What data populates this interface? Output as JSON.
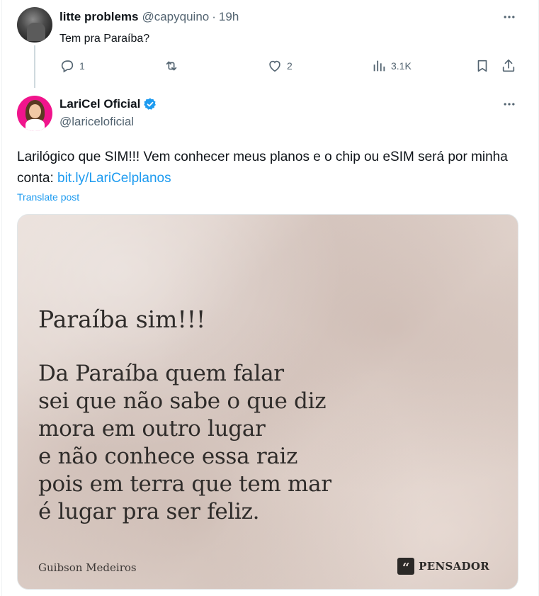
{
  "reply": {
    "name": "litte problems",
    "handle": "@capyquino",
    "separator": "·",
    "time": "19h",
    "text": "Tem pra Paraíba?",
    "actions": {
      "reply_count": "1",
      "retweet_count": "",
      "like_count": "2",
      "view_count": "3.1K"
    }
  },
  "main": {
    "name": "LariCel Oficial",
    "handle": "@lariceloficial",
    "verified": true,
    "text_prefix": "Larilógico que SIM!!! Vem conhecer meus planos e o chip ou eSIM  será por minha conta: ",
    "link": "bit.ly/LariCelplanos",
    "translate": "Translate post"
  },
  "media": {
    "title": "Paraíba sim!!!",
    "lines": [
      "Da Paraíba quem falar",
      "sei que não sabe o que diz",
      "mora em outro lugar",
      "e não conhece essa raiz",
      "pois em terra que tem mar",
      "é lugar pra ser feliz."
    ],
    "author": "Guibson Medeiros",
    "brand": "PENSADOR",
    "brand_mark": "“"
  },
  "icons": {
    "more": "more-icon",
    "reply": "reply-icon",
    "retweet": "retweet-icon",
    "like": "like-icon",
    "views": "views-icon",
    "bookmark": "bookmark-icon",
    "share": "share-icon",
    "verified": "verified-badge-icon"
  },
  "colors": {
    "link": "#1d9bf0",
    "muted": "#536471",
    "verified": "#1d9bf0"
  }
}
